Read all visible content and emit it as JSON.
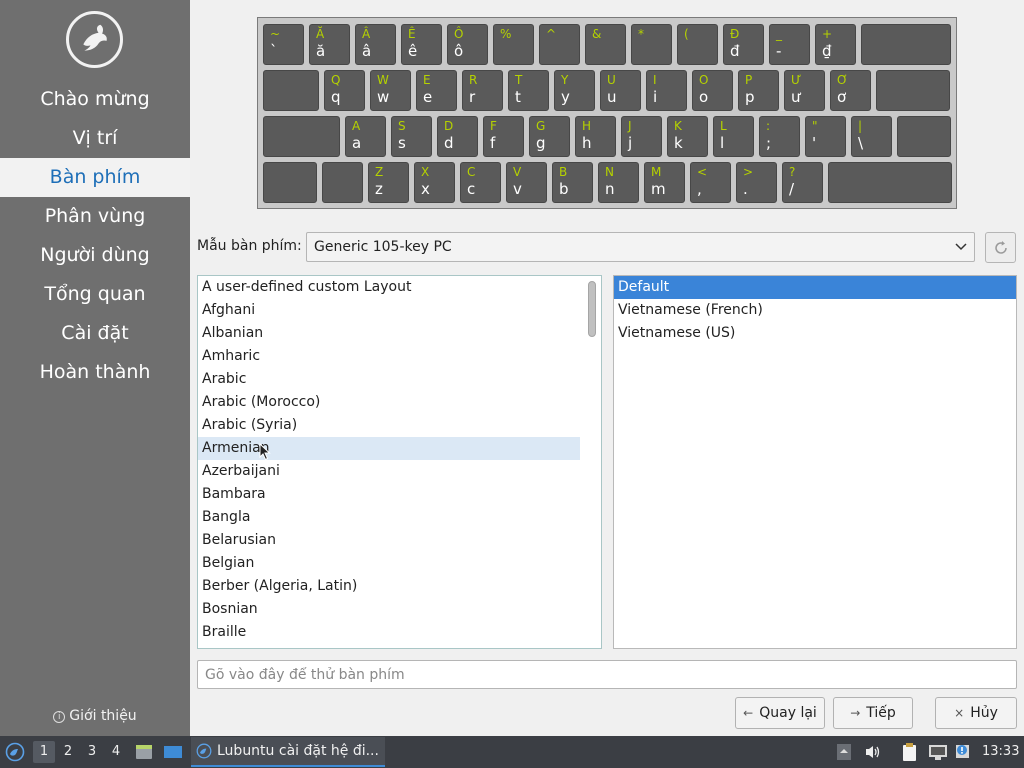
{
  "sidebar": {
    "steps": [
      {
        "label": "Chào mừng",
        "active": false
      },
      {
        "label": "Vị trí",
        "active": false
      },
      {
        "label": "Bàn phím",
        "active": true
      },
      {
        "label": "Phân vùng",
        "active": false
      },
      {
        "label": "Người dùng",
        "active": false
      },
      {
        "label": "Tổng quan",
        "active": false
      },
      {
        "label": "Cài đặt",
        "active": false
      },
      {
        "label": "Hoàn thành",
        "active": false
      }
    ],
    "about_label": "Giới thiệu"
  },
  "keyboard": {
    "rows": [
      [
        [
          "~",
          "`"
        ],
        [
          "Ă",
          "ă"
        ],
        [
          "Â",
          "â"
        ],
        [
          "Ê",
          "ê"
        ],
        [
          "Ô",
          "ô"
        ],
        [
          "%",
          ""
        ],
        [
          "^",
          ""
        ],
        [
          "&",
          ""
        ],
        [
          "*",
          ""
        ],
        [
          "(",
          ""
        ],
        [
          "Đ",
          "đ"
        ],
        [
          "_",
          "-"
        ],
        [
          "+",
          "₫"
        ],
        [
          "",
          ""
        ]
      ],
      [
        [
          "",
          ""
        ],
        [
          "Q",
          "q"
        ],
        [
          "W",
          "w"
        ],
        [
          "E",
          "e"
        ],
        [
          "R",
          "r"
        ],
        [
          "T",
          "t"
        ],
        [
          "Y",
          "y"
        ],
        [
          "U",
          "u"
        ],
        [
          "I",
          "i"
        ],
        [
          "O",
          "o"
        ],
        [
          "P",
          "p"
        ],
        [
          "Ư",
          "ư"
        ],
        [
          "Ơ",
          "ơ"
        ],
        [
          "",
          ""
        ]
      ],
      [
        [
          "",
          ""
        ],
        [
          "A",
          "a"
        ],
        [
          "S",
          "s"
        ],
        [
          "D",
          "d"
        ],
        [
          "F",
          "f"
        ],
        [
          "G",
          "g"
        ],
        [
          "H",
          "h"
        ],
        [
          "J",
          "j"
        ],
        [
          "K",
          "k"
        ],
        [
          "L",
          "l"
        ],
        [
          ":",
          ";"
        ],
        [
          "\"",
          "'"
        ],
        [
          "|",
          "\\"
        ],
        [
          "",
          ""
        ]
      ],
      [
        [
          "",
          ""
        ],
        [
          "",
          ""
        ],
        [
          "Z",
          "z"
        ],
        [
          "X",
          "x"
        ],
        [
          "C",
          "c"
        ],
        [
          "V",
          "v"
        ],
        [
          "B",
          "b"
        ],
        [
          "N",
          "n"
        ],
        [
          "M",
          "m"
        ],
        [
          "<",
          ","
        ],
        [
          ">",
          "."
        ],
        [
          "?",
          "/"
        ],
        [
          "",
          ""
        ]
      ]
    ]
  },
  "model": {
    "label": "Mẫu bàn phím:",
    "value": "Generic 105-key PC"
  },
  "layouts": [
    "A user-defined custom Layout",
    "Afghani",
    "Albanian",
    "Amharic",
    "Arabic",
    "Arabic (Morocco)",
    "Arabic (Syria)",
    "Armenian",
    "Azerbaijani",
    "Bambara",
    "Bangla",
    "Belarusian",
    "Belgian",
    "Berber (Algeria, Latin)",
    "Bosnian",
    "Braille"
  ],
  "layouts_hover_index": 7,
  "variants": [
    "Default",
    "Vietnamese (French)",
    "Vietnamese (US)"
  ],
  "variants_selected_index": 0,
  "test_input": {
    "placeholder": "Gõ vào đây để thử bàn phím",
    "value": ""
  },
  "buttons": {
    "back": "Quay lại",
    "next": "Tiếp",
    "cancel": "Hủy"
  },
  "taskbar": {
    "desktops": [
      "1",
      "2",
      "3",
      "4"
    ],
    "active_desktop": 0,
    "task_label": "Lubuntu cài đặt hệ đi...",
    "clock": "13:33"
  },
  "colors": {
    "accent": "#3a84d8",
    "sidebar": "#6f6f6f",
    "key_top_label": "#b5d200"
  }
}
